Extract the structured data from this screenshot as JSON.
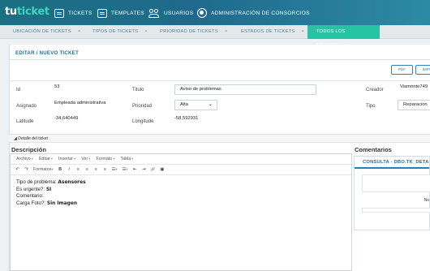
{
  "nav": {
    "logo_main": "tu",
    "logo_rest": "ticket",
    "items": [
      {
        "label": "TICKETS",
        "icon": "tickets-icon"
      },
      {
        "label": "TEMPLATES",
        "icon": "templates-icon"
      },
      {
        "label": "USUARIOS",
        "icon": "users-icon"
      },
      {
        "label": "ADMINISTRACIÓN DE CONSORCIOS",
        "icon": "admin-icon"
      }
    ]
  },
  "tabs": [
    {
      "label": "UBICACIÓN DE TICKETS",
      "close": "×"
    },
    {
      "label": "TIPOS DE TICKETS",
      "close": "×"
    },
    {
      "label": "PRIORIDAD DE TICKETS",
      "close": "×"
    },
    {
      "label": "ESTADOS DE TICKETS",
      "close": "×"
    },
    {
      "label": "TODOS LOS TICKETS",
      "close": "×"
    }
  ],
  "colors": {
    "active_tab": "#26c4a3",
    "nav_bg": "#1f6a8c",
    "accent": "#2a6f95"
  },
  "panel": {
    "title": "EDITAR / NUEVO TICKET",
    "pdf_label": "PDF",
    "print_label": "IMPRI"
  },
  "fields": {
    "id_label": "Id",
    "id_value": "53",
    "titulo_label": "Titulo",
    "titulo_value": "Aviso de problemas",
    "creador_label": "Creador",
    "creador_value": "Viamonte749",
    "asignado_label": "Asignado",
    "asignado_value": "Empleada administrativa",
    "prioridad_label": "Prioridad",
    "prioridad_value": "Alta",
    "tipo_label": "Tipo",
    "tipo_value": "Reparacion",
    "latitud_label": "Latitude",
    "latitud_value": "-34,640449",
    "longitud_label": "Longitude",
    "longitud_value": "-58,592931"
  },
  "detail": {
    "toggle": "◢",
    "label": "Detalle del ticket"
  },
  "descripcion": {
    "heading": "Descripción",
    "menu": [
      {
        "label": "Archivo",
        "dd": "▾"
      },
      {
        "label": "Editar",
        "dd": "▾"
      },
      {
        "label": "Insertar",
        "dd": "▾"
      },
      {
        "label": "Ver",
        "dd": "▾"
      },
      {
        "label": "Formato",
        "dd": "▾"
      },
      {
        "label": "Tabla",
        "dd": "▾"
      }
    ],
    "toolbar": {
      "undo": "↶",
      "redo": "↷",
      "formats": "Formatos",
      "formats_dd": "▾",
      "bold": "B",
      "italic": "I",
      "align_left": "≡",
      "align_center": "≡",
      "align_right": "≡",
      "align_justify": "≡",
      "bullet_list": "☰",
      "bullet_dd": "▾",
      "num_list": "☰",
      "num_dd": "▾",
      "outdent": "⇤",
      "indent": "⇥",
      "link": "🔗",
      "image": "▣"
    },
    "lines": [
      {
        "label": "Tipo de problema: ",
        "value": "Asensores"
      },
      {
        "label": "Es urgente?: ",
        "value": "SI"
      },
      {
        "label": "Comentario: ",
        "value": ""
      },
      {
        "label": "Carga Foto?: ",
        "value": "Sin Imagen"
      }
    ]
  },
  "comentarios": {
    "heading": "Comentarios",
    "panel_title": "CONSULTA - DBO.TK_DETALLE",
    "no_text": "No"
  }
}
